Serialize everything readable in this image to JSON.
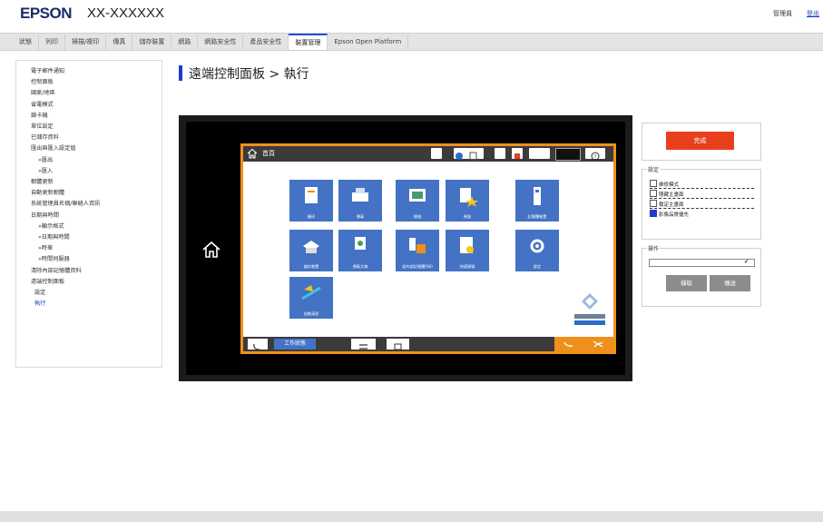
{
  "header": {
    "logo": "EPSON",
    "model": "XX-XXXXXX",
    "admin": "管理員",
    "logout": "登出"
  },
  "tabs": [
    "狀態",
    "列印",
    "掃描/複印",
    "傳真",
    "儲存裝置",
    "網路",
    "網路安全性",
    "產品安全性",
    "裝置管理",
    "Epson Open Platform"
  ],
  "active_tab_index": 8,
  "nav": [
    {
      "label": "電子郵件通知",
      "level": 0
    },
    {
      "label": "控制面板",
      "level": 0
    },
    {
      "label": "國家/地區",
      "level": 0
    },
    {
      "label": "省電模式",
      "level": 0
    },
    {
      "label": "鎖卡機",
      "level": 0
    },
    {
      "label": "單位設定",
      "level": 0
    },
    {
      "label": "已儲存資料",
      "level": 0
    },
    {
      "label": "匯出與匯入設定值",
      "level": 0
    },
    {
      "label": "»匯出",
      "level": 1
    },
    {
      "label": "»匯入",
      "level": 1
    },
    {
      "label": "韌體更新",
      "level": 0
    },
    {
      "label": "自動更新韌體",
      "level": 0
    },
    {
      "label": "系統管理員名稱/聯絡人資訊",
      "level": 0
    },
    {
      "label": "日期與時間",
      "level": 0
    },
    {
      "label": "»顯示格式",
      "level": 1
    },
    {
      "label": "»日期與時間",
      "level": 1
    },
    {
      "label": "»時差",
      "level": 1
    },
    {
      "label": "»時間伺服器",
      "level": 1
    },
    {
      "label": "清除內部記憶體資料",
      "level": 0
    },
    {
      "label": "遠端控制面板",
      "level": 0
    },
    {
      "label": "設定",
      "level": 2
    },
    {
      "label": "執行",
      "level": 2,
      "active": true
    }
  ],
  "page_title": "遠端控制面板 > 執行",
  "panel": {
    "home_label": "首頁",
    "tiles": [
      "複印",
      "傳真",
      "掃描",
      "預設",
      "記憶體裝置",
      "儲存裝置",
      "傳真方塊",
      "從內部記憶體列印",
      "快速撥號",
      "設定",
      "自動清潔"
    ],
    "job_status": "工作狀態"
  },
  "right": {
    "done": "完成",
    "settings_legend": "設定",
    "options": [
      {
        "label": "維修模式",
        "checked": false
      },
      {
        "label": "隱藏主畫面",
        "checked": false
      },
      {
        "label": "鎖定主畫面",
        "checked": false
      },
      {
        "label": "影像品質優先",
        "checked": true
      }
    ],
    "notify_legend": "操作",
    "btn_fetch": "擷取",
    "btn_send": "傳送"
  },
  "colors": {
    "accent": "#1a3cc8",
    "tile": "#4472c4",
    "panel_frame": "#f0901c",
    "done": "#e8401c"
  }
}
